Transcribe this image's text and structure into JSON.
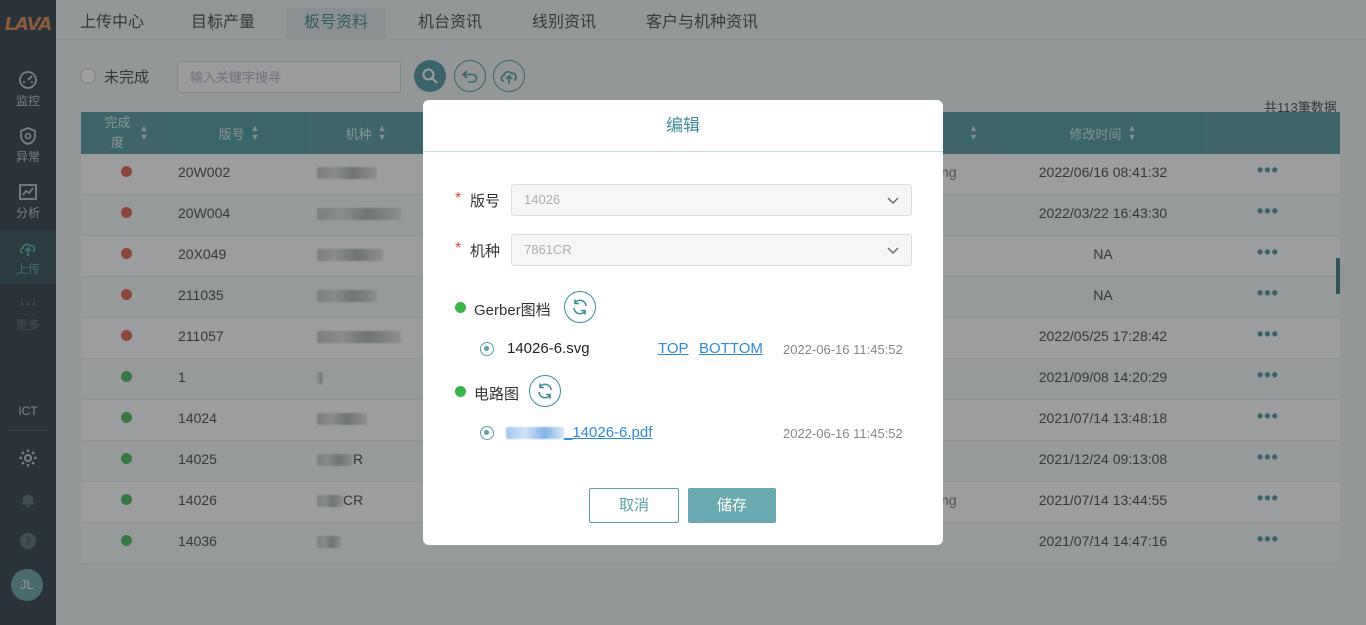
{
  "sidebar": {
    "logo": "LAVA",
    "items": [
      {
        "label": "监控",
        "icon": "gauge-icon"
      },
      {
        "label": "异常",
        "icon": "shield-alert-icon"
      },
      {
        "label": "分析",
        "icon": "chart-icon"
      },
      {
        "label": "上传",
        "icon": "upload-cloud-icon"
      },
      {
        "label": "更多",
        "icon": "more-dots-icon"
      }
    ],
    "section": "ICT",
    "avatar": "JL"
  },
  "tabs": {
    "upload_center": "上传中心",
    "target_output": "目标产量",
    "board_info": "板号资料",
    "machine_info": "机台资讯",
    "line_info": "线别资讯",
    "customer_model_info": "客户与机种资讯"
  },
  "toolbar": {
    "incomplete_label": "未完成",
    "search_placeholder": "输入关键字搜寻",
    "total": "共113筆数据"
  },
  "table": {
    "headers": {
      "complete": "完成度",
      "board": "版号",
      "model": "机种",
      "modified": "修改时间"
    },
    "rows": [
      {
        "status": "red",
        "board": "20W002",
        "partial": "ng",
        "time": "2022/06/16 08:41:32"
      },
      {
        "status": "red",
        "board": "20W004",
        "partial": "",
        "time": "2022/03/22 16:43:30"
      },
      {
        "status": "red",
        "board": "20X049",
        "partial": "",
        "time": "NA"
      },
      {
        "status": "red",
        "board": "211035",
        "partial": "",
        "time": "NA"
      },
      {
        "status": "red",
        "board": "211057",
        "partial": "",
        "time": "2022/05/25 17:28:42"
      },
      {
        "status": "green",
        "board": "1",
        "partial": "",
        "time": "2021/09/08 14:20:29"
      },
      {
        "status": "green",
        "board": "14024",
        "partial": "",
        "time": "2021/07/14 13:48:18"
      },
      {
        "status": "green",
        "board": "14025",
        "model_suffix": "R",
        "partial": "",
        "time": "2021/12/24 09:13:08"
      },
      {
        "status": "green",
        "board": "14026",
        "model_suffix": "CR",
        "partial": "ng",
        "time": "2021/07/14 13:44:55"
      },
      {
        "status": "green",
        "board": "14036",
        "partial": "",
        "time": "2021/07/14 14:47:16"
      }
    ],
    "more": "•••"
  },
  "modal": {
    "title": "编辑",
    "board_label": "版号",
    "board_value": "14026",
    "model_label": "机种",
    "model_value": "7861CR",
    "gerber_label": "Gerber图档",
    "gerber_file": "14026-6.svg",
    "top_link": "TOP",
    "bottom_link": "BOTTOM",
    "gerber_time": "2022-06-16 11:45:52",
    "circuit_label": "电路图",
    "circuit_file": "_14026-6.pdf",
    "circuit_time": "2022-06-16 11:45:52",
    "cancel": "取消",
    "save": "储存"
  },
  "colors": {
    "accent": "#3d8d97",
    "sidebar_bg": "#1d2b35",
    "status_red": "#e0513b",
    "status_green": "#3ab54a"
  }
}
